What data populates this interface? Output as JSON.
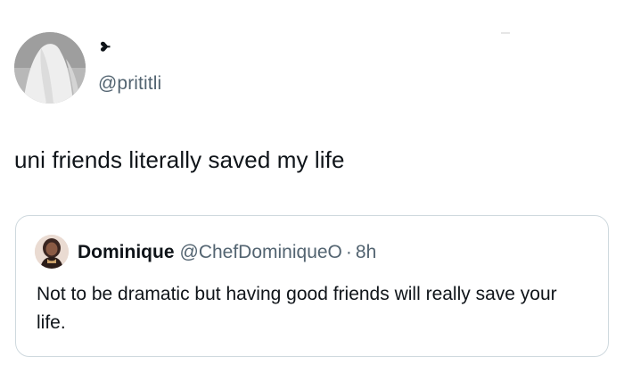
{
  "post": {
    "display_name_icon": "heart-glyph-icon",
    "handle": "@prititli",
    "text": "uni friends literally saved my life"
  },
  "quoted": {
    "name": "Dominique",
    "handle": "@ChefDominiqueO",
    "separator": "·",
    "time": "8h",
    "text": "Not to be dramatic but having good friends will really save your life."
  },
  "colors": {
    "text_primary": "#0f1419",
    "text_secondary": "#536471",
    "border": "#cfd9de"
  }
}
